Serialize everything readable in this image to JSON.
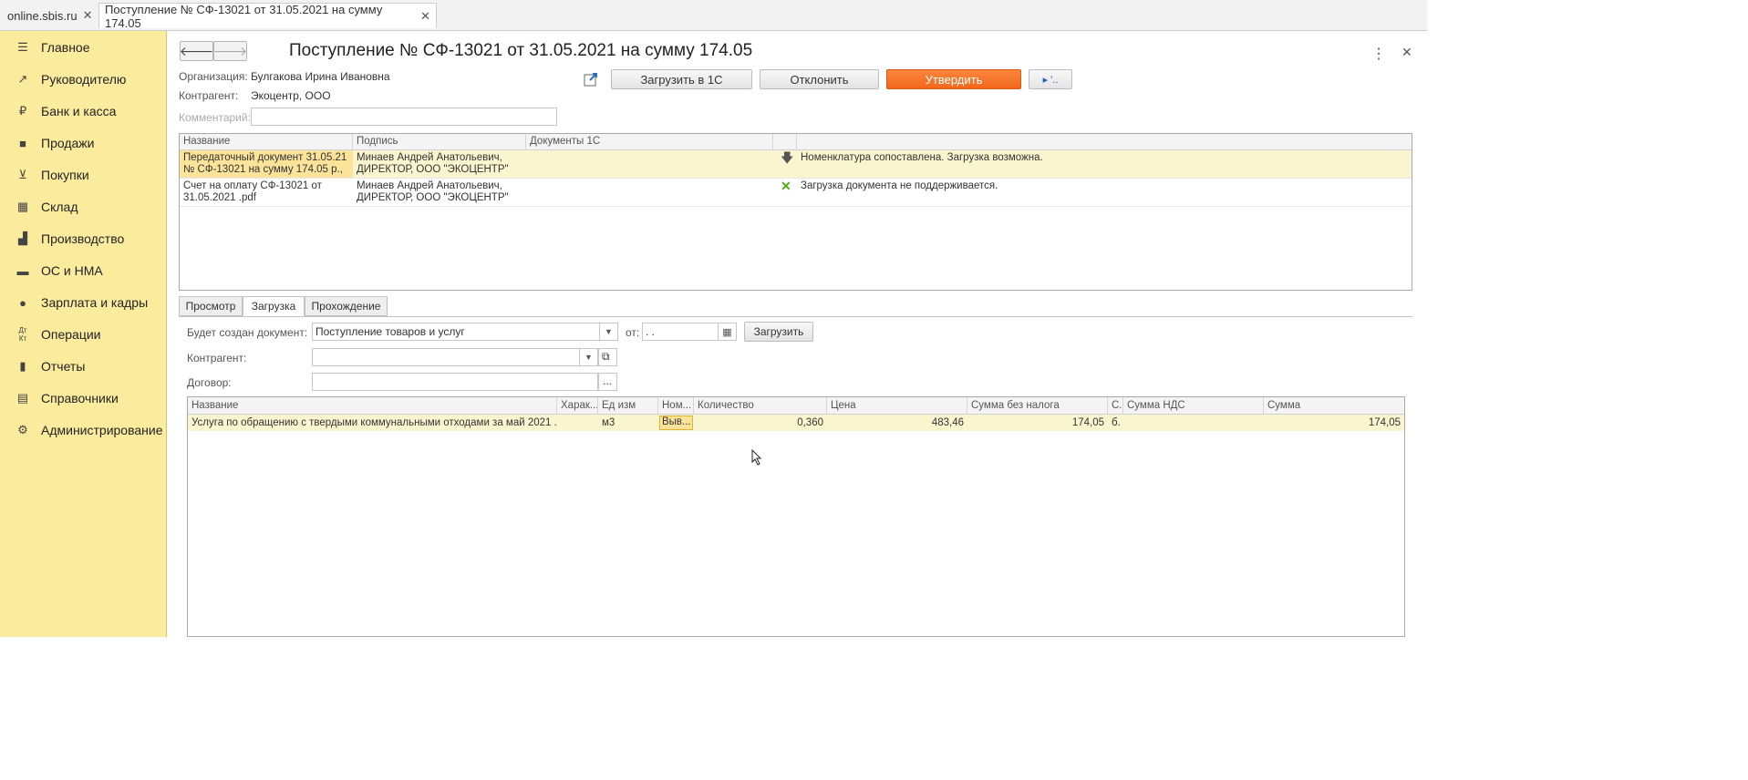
{
  "tabs": [
    {
      "label": "online.sbis.ru",
      "close": "✕"
    },
    {
      "label": "Поступление № СФ-13021 от 31.05.2021 на сумму 174.05",
      "close": "✕"
    }
  ],
  "sidebar": {
    "items": [
      {
        "label": "Главное",
        "icon": "menu-icon"
      },
      {
        "label": "Руководителю",
        "icon": "trend-icon"
      },
      {
        "label": "Банк и касса",
        "icon": "ruble-icon"
      },
      {
        "label": "Продажи",
        "icon": "bag-icon"
      },
      {
        "label": "Покупки",
        "icon": "cart-icon"
      },
      {
        "label": "Склад",
        "icon": "warehouse-icon"
      },
      {
        "label": "Производство",
        "icon": "factory-icon"
      },
      {
        "label": "ОС и НМА",
        "icon": "truck-icon"
      },
      {
        "label": "Зарплата и кадры",
        "icon": "person-icon"
      },
      {
        "label": "Операции",
        "icon": "dtkt-icon"
      },
      {
        "label": "Отчеты",
        "icon": "bar-chart-icon"
      },
      {
        "label": "Справочники",
        "icon": "book-icon"
      },
      {
        "label": "Администрирование",
        "icon": "gear-icon"
      }
    ]
  },
  "header": {
    "title": "Поступление № СФ-13021 от 31.05.2021 на сумму 174.05"
  },
  "info": {
    "org_label": "Организация:",
    "org_value": "Булгакова Ирина Ивановна",
    "contractor_label": "Контрагент:",
    "contractor_value": "Экоцентр, ООО",
    "comment_label": "Комментарий:",
    "comment_value": ""
  },
  "toolbar": {
    "load_1c": "Загрузить в 1С",
    "reject": "Отклонить",
    "approve": "Утвердить",
    "more": "▸ '.."
  },
  "docs_table": {
    "headers": [
      "Название",
      "Подпись",
      "Документы 1С",
      ""
    ],
    "rows": [
      {
        "name": "Передаточный документ 31.05.21 № СФ-13021 на сумму 174.05 р., ...",
        "sign": "Минаев Андрей Анатольевич, ДИРЕКТОР, ООО \"ЭКОЦЕНТР\"",
        "docs1c": "",
        "status_icon": "download-arrow-icon",
        "status": "Номенклатура сопоставлена. Загрузка возможна."
      },
      {
        "name": "Счет на оплату СФ-13021 от 31.05.2021 .pdf",
        "sign": "Минаев Андрей Анатольевич, ДИРЕКТОР, ООО \"ЭКОЦЕНТР\"",
        "docs1c": "",
        "status_icon": "cross-icon",
        "status": "Загрузка документа не поддерживается."
      }
    ]
  },
  "subtabs": [
    "Просмотр",
    "Загрузка",
    "Прохождение"
  ],
  "load": {
    "doc_label": "Будет создан документ:",
    "doc_value": "Поступление товаров и услуг",
    "date_label": "от:",
    "date_value": " .  .",
    "load_btn": "Загрузить",
    "contractor_label": "Контрагент:",
    "contractor_value": "",
    "contract_label": "Договор:",
    "contract_value": ""
  },
  "items_table": {
    "headers": [
      "Название",
      "Харак...",
      "Ед изм",
      "Ном...",
      "Количество",
      "Цена",
      "Сумма без налога",
      "С.",
      "Сумма НДС",
      "Сумма"
    ],
    "rows": [
      {
        "name": "Услуга по обращению с твердыми коммунальными отходами за май 2021 ...",
        "char": "",
        "unit": "м3",
        "nom": "Выв...",
        "qty": "0,360",
        "price": "483,46",
        "sum_no_tax": "174,05",
        "s": "б.",
        "vat": "",
        "sum": "174,05"
      }
    ]
  },
  "colors": {
    "sidebar": "#fbec9d",
    "approve": "#f2671a",
    "selected_row": "#fbf5cf"
  }
}
